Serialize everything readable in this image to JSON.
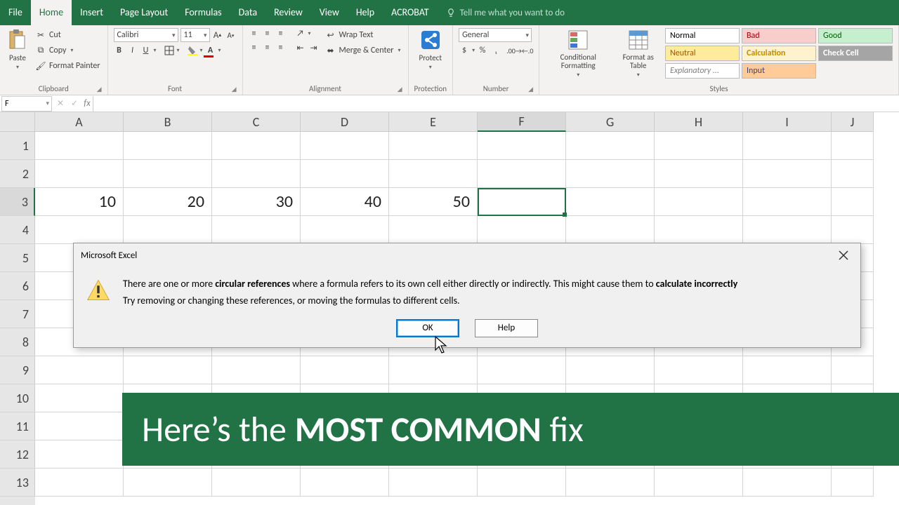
{
  "tabs": {
    "file": "File",
    "home": "Home",
    "insert": "Insert",
    "page_layout": "Page Layout",
    "formulas": "Formulas",
    "data": "Data",
    "review": "Review",
    "view": "View",
    "help": "Help",
    "acrobat": "ACROBAT",
    "tellme": "Tell me what you want to do"
  },
  "ribbon": {
    "clipboard": {
      "label": "Clipboard",
      "paste": "Paste",
      "cut": "Cut",
      "copy": "Copy",
      "format_painter": "Format Painter"
    },
    "font": {
      "label": "Font",
      "name": "Calibri",
      "size": "11",
      "bold": "B",
      "italic": "I",
      "underline": "U"
    },
    "alignment": {
      "label": "Alignment",
      "wrap": "Wrap Text",
      "merge": "Merge & Center"
    },
    "protect": {
      "label": "Protection",
      "protect": "Protect"
    },
    "number": {
      "label": "Number",
      "format": "General"
    },
    "styles": {
      "label": "Styles",
      "cond": "Conditional Formatting",
      "table": "Format as Table",
      "cells": [
        {
          "text": "Normal",
          "bg": "#ffffff",
          "fg": "#000"
        },
        {
          "text": "Bad",
          "bg": "#f8cecc",
          "fg": "#9c0006"
        },
        {
          "text": "Good",
          "bg": "#c6efce",
          "fg": "#006100"
        },
        {
          "text": "Neutral",
          "bg": "#ffeb9c",
          "fg": "#9c5700"
        },
        {
          "text": "Calculation",
          "bg": "#fff2cc",
          "fg": "#bf8f00"
        },
        {
          "text": "Check Cell",
          "bg": "#a5a5a5",
          "fg": "#ffffff"
        },
        {
          "text": "Explanatory ...",
          "bg": "#ffffff",
          "fg": "#7f7f7f"
        },
        {
          "text": "Input",
          "bg": "#ffcc99",
          "fg": "#3f3f76"
        }
      ]
    }
  },
  "namebox": "F",
  "columns": [
    "A",
    "B",
    "C",
    "D",
    "E",
    "F",
    "G",
    "H",
    "I",
    "J"
  ],
  "rows_visible": 13,
  "selected": {
    "row": 3,
    "col": "F"
  },
  "data_row3": [
    "10",
    "20",
    "30",
    "40",
    "50",
    "",
    "",
    "",
    "",
    ""
  ],
  "dialog": {
    "title": "Microsoft Excel",
    "msg_pre": "There are one or more ",
    "msg_bold1": "circular references",
    "msg_mid": " where a formula refers to its own cell either directly or indirectly. This might cause them to ",
    "msg_bold2": "calculate incorrectly",
    "msg_line2": "Try removing or changing these references, or moving the formulas to different cells.",
    "ok": "OK",
    "help": "Help"
  },
  "banner": {
    "pre": "Here’s the ",
    "bold": "MOST COMMON",
    "post": " fix"
  }
}
